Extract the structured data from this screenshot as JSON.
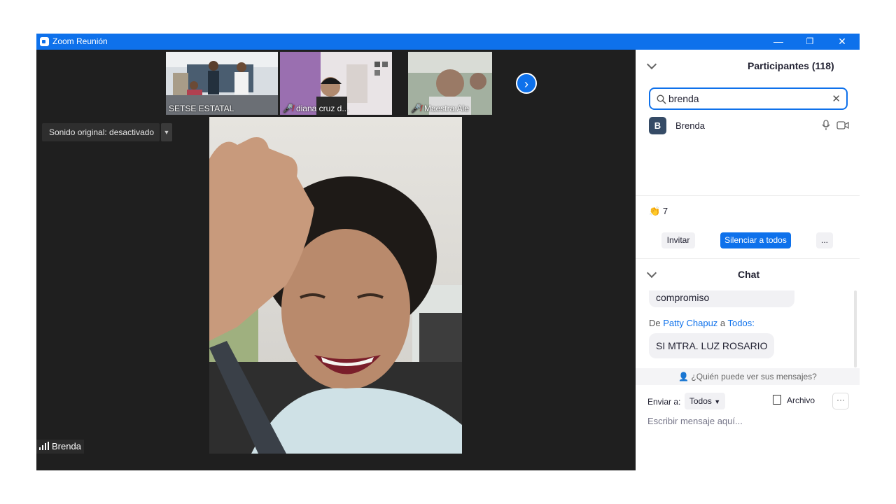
{
  "window": {
    "title": "Zoom Reunión",
    "controls": {
      "minimize": "—",
      "restore": "❐",
      "close": "✕"
    }
  },
  "video": {
    "thumbnails": [
      {
        "label": "SETSE ESTATAL",
        "muted": false
      },
      {
        "label": "diana cruz d...",
        "muted": true
      },
      {
        "label": "Maestra:Ale",
        "muted": true
      }
    ],
    "next_icon": "›",
    "sound_button": "Sonido original: desactivado",
    "sound_arrow": "▼",
    "active_speaker": "Brenda"
  },
  "participants": {
    "header": "Participantes (118)",
    "search_value": "brenda",
    "clear_icon": "✕",
    "list": [
      {
        "initial": "B",
        "name": "Brenda"
      }
    ],
    "reaction_count": "7",
    "invite_label": "Invitar",
    "mute_all_label": "Silenciar a todos",
    "more_label": "..."
  },
  "chat": {
    "header": "Chat",
    "prev_message": "compromiso",
    "sender_prefix": "De",
    "sender_name": "Patty Chapuz",
    "sender_mid": "a",
    "sender_target": "Todos:",
    "message": "SI MTRA. LUZ ROSARIO",
    "privacy_text": "¿Quién puede ver sus mensajes?",
    "send_to_label": "Enviar a:",
    "send_to_value": "Todos",
    "file_label": "Archivo",
    "more_label": "···",
    "input_placeholder": "Escribir mensaje aquí..."
  },
  "colors": {
    "accent": "#0e71eb",
    "titlebar": "#0e71eb",
    "video_bg": "#1f1f1f"
  }
}
